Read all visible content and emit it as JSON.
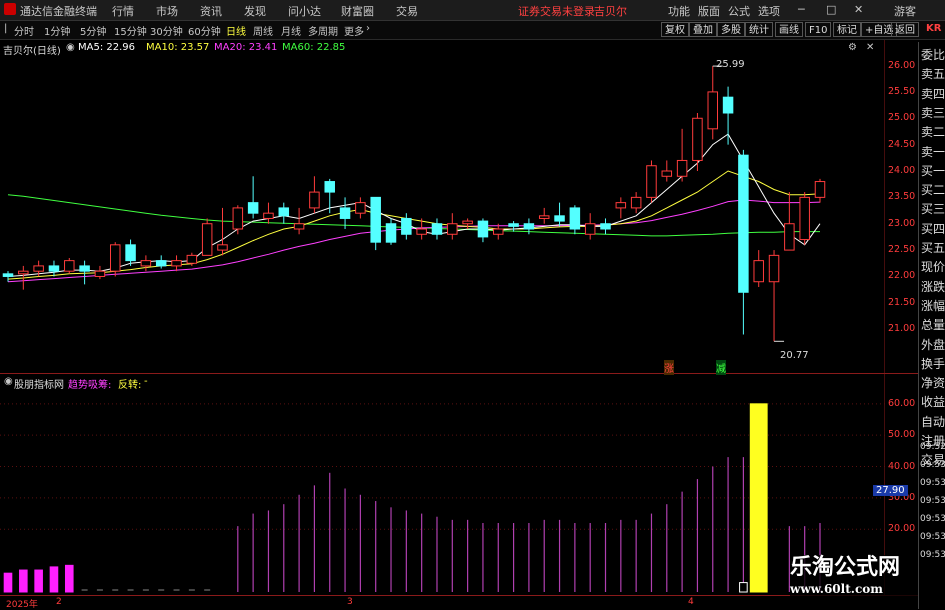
{
  "menu": {
    "app_title": "通达信金融终端",
    "items": [
      "行情",
      "市场",
      "资讯",
      "发现",
      "问小达",
      "财富圈",
      "交易"
    ],
    "notice": "证券交易未登录",
    "stock": "吉贝尔",
    "right_items": [
      "功能",
      "版面",
      "公式",
      "选项"
    ],
    "guest": "游客"
  },
  "toolbar": {
    "periods": [
      "分时",
      "1分钟",
      "5分钟",
      "15分钟",
      "30分钟",
      "60分钟",
      "日线",
      "周线",
      "月线",
      "多周期",
      "更多"
    ],
    "active_period": "日线",
    "buttons": [
      "复权",
      "叠加",
      "多股",
      "统计",
      "画线",
      "F10",
      "标记",
      "+自选",
      "返回"
    ],
    "kr_label": "KR"
  },
  "main_chart": {
    "name": "吉贝尔(日线)",
    "ma_legend": [
      {
        "label": "MA5: 22.96",
        "color": "#ffffff"
      },
      {
        "label": "MA10: 23.57",
        "color": "#ffff40"
      },
      {
        "label": "MA20: 23.41",
        "color": "#ff40ff"
      },
      {
        "label": "MA60: 22.85",
        "color": "#40ff40"
      }
    ],
    "y_ticks": [
      "26.00",
      "25.50",
      "25.00",
      "24.50",
      "24.00",
      "23.50",
      "23.00",
      "22.50",
      "22.00",
      "21.50",
      "21.00"
    ],
    "high_label": "25.99",
    "low_label": "20.77",
    "markers": [
      "涨",
      "减"
    ]
  },
  "indicator": {
    "name": "股朋指标网",
    "label1": "趋势吸筹:",
    "label2": "反转:",
    "label2_value": "-",
    "y_ticks": [
      "60.00",
      "50.00",
      "40.00",
      "30.00",
      "20.00"
    ],
    "current_value": "27.90"
  },
  "x_labels": [
    "2025年",
    "2",
    "3",
    "4"
  ],
  "right_panel": {
    "items": [
      "委比",
      "卖五",
      "卖四",
      "卖三",
      "卖二",
      "卖一",
      "买一",
      "买二",
      "买三",
      "买四",
      "买五",
      "现价",
      "涨跌",
      "涨幅",
      "总量",
      "外盘",
      "换手",
      "净资",
      "收益",
      "自动",
      "注册",
      "交易"
    ],
    "times": [
      "09:52",
      "09:53",
      "09:53",
      "09:53",
      "09:53",
      "09:53",
      "09:53"
    ]
  },
  "watermark": {
    "title": "乐淘公式网",
    "url": "www.60lt.com"
  },
  "chart_data": {
    "type": "candlestick",
    "ylim": [
      20.7,
      26.2
    ],
    "candles": [
      {
        "o": 22.05,
        "c": 22.0,
        "h": 22.1,
        "l": 21.9
      },
      {
        "o": 22.05,
        "c": 22.1,
        "h": 22.2,
        "l": 21.75
      },
      {
        "o": 22.1,
        "c": 22.2,
        "h": 22.3,
        "l": 22.0
      },
      {
        "o": 22.2,
        "c": 22.1,
        "h": 22.3,
        "l": 22.0
      },
      {
        "o": 22.1,
        "c": 22.3,
        "h": 22.35,
        "l": 22.05
      },
      {
        "o": 22.2,
        "c": 22.1,
        "h": 22.3,
        "l": 21.85
      },
      {
        "o": 22.0,
        "c": 22.1,
        "h": 22.2,
        "l": 21.95
      },
      {
        "o": 22.1,
        "c": 22.6,
        "h": 22.65,
        "l": 22.0
      },
      {
        "o": 22.6,
        "c": 22.3,
        "h": 22.7,
        "l": 22.2
      },
      {
        "o": 22.2,
        "c": 22.3,
        "h": 22.4,
        "l": 22.1
      },
      {
        "o": 22.3,
        "c": 22.2,
        "h": 22.4,
        "l": 22.15
      },
      {
        "o": 22.2,
        "c": 22.3,
        "h": 22.4,
        "l": 22.1
      },
      {
        "o": 22.25,
        "c": 22.4,
        "h": 22.45,
        "l": 22.2
      },
      {
        "o": 22.4,
        "c": 23.0,
        "h": 23.1,
        "l": 22.4
      },
      {
        "o": 22.5,
        "c": 22.6,
        "h": 23.3,
        "l": 22.4
      },
      {
        "o": 22.9,
        "c": 23.3,
        "h": 23.35,
        "l": 22.8
      },
      {
        "o": 23.4,
        "c": 23.2,
        "h": 23.9,
        "l": 23.1
      },
      {
        "o": 23.1,
        "c": 23.2,
        "h": 23.4,
        "l": 23.0
      },
      {
        "o": 23.3,
        "c": 23.15,
        "h": 23.4,
        "l": 23.0
      },
      {
        "o": 22.9,
        "c": 23.0,
        "h": 23.3,
        "l": 22.8
      },
      {
        "o": 23.3,
        "c": 23.6,
        "h": 23.9,
        "l": 23.2
      },
      {
        "o": 23.8,
        "c": 23.6,
        "h": 23.85,
        "l": 23.2
      },
      {
        "o": 23.3,
        "c": 23.1,
        "h": 23.5,
        "l": 22.9
      },
      {
        "o": 23.2,
        "c": 23.4,
        "h": 23.5,
        "l": 23.1
      },
      {
        "o": 23.5,
        "c": 22.65,
        "h": 23.5,
        "l": 22.5
      },
      {
        "o": 23.0,
        "c": 22.65,
        "h": 23.1,
        "l": 22.6
      },
      {
        "o": 23.1,
        "c": 22.8,
        "h": 23.2,
        "l": 22.7
      },
      {
        "o": 22.8,
        "c": 22.9,
        "h": 23.1,
        "l": 22.7
      },
      {
        "o": 23.0,
        "c": 22.8,
        "h": 23.1,
        "l": 22.7
      },
      {
        "o": 22.8,
        "c": 23.0,
        "h": 23.2,
        "l": 22.7
      },
      {
        "o": 23.0,
        "c": 23.05,
        "h": 23.1,
        "l": 22.9
      },
      {
        "o": 23.05,
        "c": 22.75,
        "h": 23.1,
        "l": 22.65
      },
      {
        "o": 22.8,
        "c": 22.9,
        "h": 23.0,
        "l": 22.7
      },
      {
        "o": 23.0,
        "c": 22.95,
        "h": 23.05,
        "l": 22.85
      },
      {
        "o": 23.0,
        "c": 22.9,
        "h": 23.1,
        "l": 22.8
      },
      {
        "o": 23.1,
        "c": 23.15,
        "h": 23.3,
        "l": 23.0
      },
      {
        "o": 23.15,
        "c": 23.05,
        "h": 23.4,
        "l": 22.95
      },
      {
        "o": 23.3,
        "c": 22.9,
        "h": 23.35,
        "l": 22.8
      },
      {
        "o": 22.8,
        "c": 23.0,
        "h": 23.2,
        "l": 22.7
      },
      {
        "o": 23.0,
        "c": 22.9,
        "h": 23.1,
        "l": 22.8
      },
      {
        "o": 23.3,
        "c": 23.4,
        "h": 23.5,
        "l": 23.1
      },
      {
        "o": 23.3,
        "c": 23.5,
        "h": 23.6,
        "l": 23.2
      },
      {
        "o": 23.5,
        "c": 24.1,
        "h": 24.2,
        "l": 23.4
      },
      {
        "o": 23.9,
        "c": 24.0,
        "h": 24.2,
        "l": 23.8
      },
      {
        "o": 23.9,
        "c": 24.2,
        "h": 24.8,
        "l": 23.8
      },
      {
        "o": 24.2,
        "c": 25.0,
        "h": 25.1,
        "l": 24.0
      },
      {
        "o": 24.8,
        "c": 25.5,
        "h": 25.99,
        "l": 24.6
      },
      {
        "o": 25.4,
        "c": 25.1,
        "h": 25.6,
        "l": 24.5
      },
      {
        "o": 24.3,
        "c": 21.7,
        "h": 24.4,
        "l": 20.9
      },
      {
        "o": 21.9,
        "c": 22.3,
        "h": 22.5,
        "l": 21.8
      },
      {
        "o": 21.9,
        "c": 22.4,
        "h": 22.5,
        "l": 20.77
      },
      {
        "o": 22.5,
        "c": 23.0,
        "h": 23.6,
        "l": 22.5
      },
      {
        "o": 22.7,
        "c": 23.5,
        "h": 23.6,
        "l": 22.6
      },
      {
        "o": 23.5,
        "c": 23.8,
        "h": 23.85,
        "l": 23.4
      }
    ],
    "ma5": [
      22.0,
      22.02,
      22.05,
      22.08,
      22.12,
      22.12,
      22.1,
      22.16,
      22.25,
      22.28,
      22.3,
      22.28,
      22.3,
      22.55,
      22.7,
      22.9,
      23.05,
      23.1,
      23.15,
      23.1,
      23.2,
      23.3,
      23.35,
      23.4,
      23.25,
      23.1,
      23.0,
      22.85,
      22.8,
      22.85,
      22.9,
      22.9,
      22.88,
      22.9,
      22.92,
      22.95,
      22.98,
      22.98,
      22.95,
      22.95,
      23.05,
      23.15,
      23.4,
      23.65,
      23.9,
      24.15,
      24.5,
      24.7,
      24.2,
      23.7,
      23.2,
      22.8,
      22.6,
      23.0
    ],
    "ma10": [
      21.95,
      21.97,
      22.0,
      22.02,
      22.05,
      22.06,
      22.07,
      22.1,
      22.13,
      22.17,
      22.2,
      22.22,
      22.24,
      22.32,
      22.42,
      22.55,
      22.68,
      22.8,
      22.9,
      22.95,
      23.05,
      23.15,
      23.22,
      23.27,
      23.2,
      23.15,
      23.1,
      23.05,
      23.0,
      22.97,
      22.95,
      22.93,
      22.9,
      22.9,
      22.9,
      22.92,
      22.94,
      22.95,
      22.95,
      22.97,
      23.0,
      23.05,
      23.15,
      23.3,
      23.45,
      23.6,
      23.8,
      24.0,
      23.9,
      23.8,
      23.65,
      23.55,
      23.55,
      23.57
    ],
    "ma20": [
      21.9,
      21.92,
      21.94,
      21.96,
      21.98,
      22.0,
      22.02,
      22.04,
      22.06,
      22.08,
      22.1,
      22.12,
      22.14,
      22.18,
      22.22,
      22.28,
      22.35,
      22.42,
      22.5,
      22.57,
      22.63,
      22.7,
      22.76,
      22.82,
      22.85,
      22.88,
      22.9,
      22.92,
      22.93,
      22.94,
      22.95,
      22.96,
      22.96,
      22.96,
      22.96,
      22.96,
      22.96,
      22.97,
      22.97,
      22.98,
      23.0,
      23.02,
      23.06,
      23.12,
      23.18,
      23.25,
      23.33,
      23.42,
      23.45,
      23.43,
      23.4,
      23.4,
      23.4,
      23.41
    ],
    "ma60": [
      23.55,
      23.52,
      23.48,
      23.44,
      23.4,
      23.36,
      23.32,
      23.28,
      23.24,
      23.2,
      23.16,
      23.13,
      23.1,
      23.07,
      23.05,
      23.04,
      23.03,
      23.02,
      23.01,
      23.0,
      22.99,
      22.98,
      22.97,
      22.96,
      22.95,
      22.94,
      22.93,
      22.92,
      22.91,
      22.9,
      22.89,
      22.88,
      22.87,
      22.86,
      22.85,
      22.84,
      22.83,
      22.82,
      22.81,
      22.8,
      22.79,
      22.78,
      22.77,
      22.77,
      22.78,
      22.79,
      22.8,
      22.82,
      22.83,
      22.84,
      22.84,
      22.85,
      22.85,
      22.85
    ],
    "indicator_lines": [
      0,
      0,
      0,
      0,
      0,
      0,
      0,
      0,
      0,
      0,
      0,
      0,
      0,
      0,
      0,
      21,
      25,
      26,
      28,
      31,
      34,
      38,
      33,
      31,
      29,
      27,
      26,
      25,
      24,
      23,
      23,
      22,
      22,
      22,
      22,
      23,
      23,
      22,
      22,
      22,
      23,
      23,
      25,
      28,
      32,
      36,
      40,
      43,
      43,
      22,
      0,
      21,
      21,
      22
    ],
    "indicator_bars": [
      6,
      7,
      7,
      8,
      8.5,
      0,
      0,
      0,
      0,
      0,
      0,
      0,
      0,
      0,
      0,
      0,
      0,
      0,
      0,
      0,
      0,
      0,
      0,
      0,
      0,
      0,
      0,
      0,
      0,
      0,
      0,
      0,
      0,
      0,
      0,
      0,
      0,
      0,
      0,
      0,
      0,
      0,
      0,
      0,
      0,
      0,
      0,
      0,
      3,
      60,
      0,
      0,
      0,
      0
    ],
    "indicator_ylim": [
      0,
      66
    ]
  }
}
